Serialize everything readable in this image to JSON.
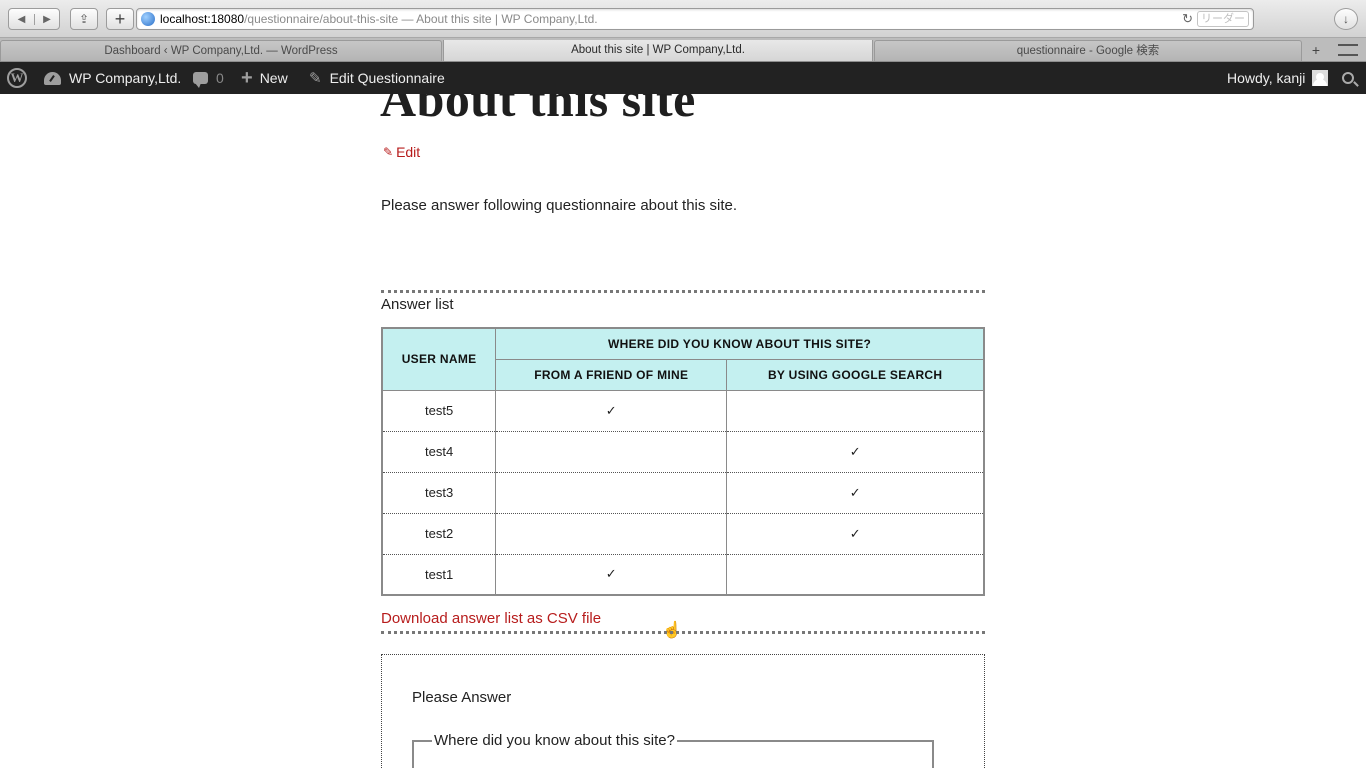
{
  "browser": {
    "url_host": "localhost:18080",
    "url_path": "/questionnaire/about-this-site",
    "url_title": " — About this site | WP Company,Ltd.",
    "reader_label": "リーダー",
    "tabs": [
      {
        "label": "Dashboard ‹ WP Company,Ltd. — WordPress"
      },
      {
        "label": "About this site | WP Company,Ltd."
      },
      {
        "label": "questionnaire - Google 検索"
      }
    ]
  },
  "adminbar": {
    "site_name": "WP Company,Ltd.",
    "comments_count": "0",
    "new_label": "New",
    "edit_label": "Edit Questionnaire",
    "howdy": "Howdy, kanji"
  },
  "page": {
    "title": "About this site",
    "edit_label": "Edit",
    "intro": "Please answer following questionnaire about this site.",
    "answer_list_label": "Answer list",
    "download_csv_label": "Download answer list as CSV file",
    "form_title": "Please Answer",
    "question_legend": "Where did you know about this site?"
  },
  "table": {
    "user_header": "USER NAME",
    "group_header": "WHERE DID YOU KNOW ABOUT THIS SITE?",
    "columns": [
      "FROM A FRIEND OF MINE",
      "BY USING GOOGLE SEARCH"
    ],
    "rows": [
      {
        "user": "test5",
        "friend": "✓",
        "google": ""
      },
      {
        "user": "test4",
        "friend": "",
        "google": "✓"
      },
      {
        "user": "test3",
        "friend": "",
        "google": "✓"
      },
      {
        "user": "test2",
        "friend": "",
        "google": "✓"
      },
      {
        "user": "test1",
        "friend": "✓",
        "google": ""
      }
    ]
  },
  "colors": {
    "link_red": "#b71c1c",
    "header_cyan": "#c4f0f0",
    "adminbar_bg": "#222222"
  }
}
